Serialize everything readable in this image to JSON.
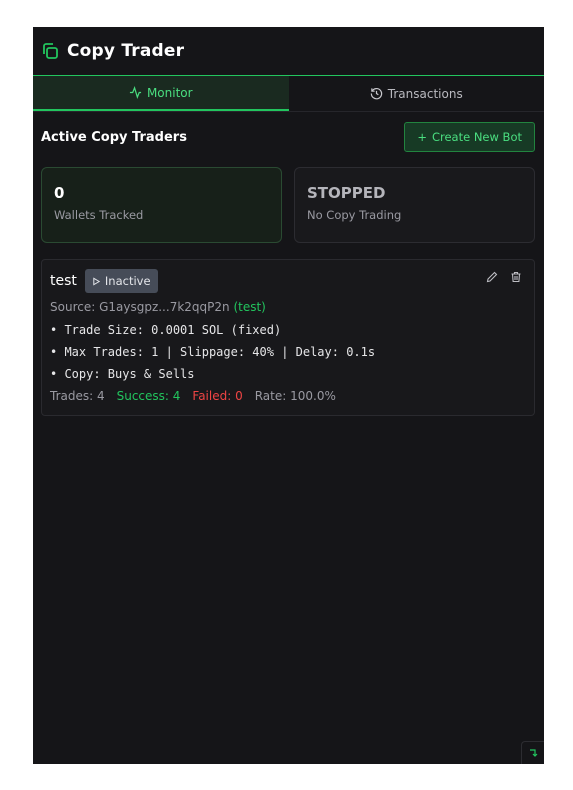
{
  "app": {
    "title": "Copy Trader"
  },
  "tabs": [
    {
      "label": "Monitor",
      "icon": "activity-icon",
      "active": true
    },
    {
      "label": "Transactions",
      "icon": "history-icon",
      "active": false
    }
  ],
  "section": {
    "title": "Active Copy Traders",
    "create_label": "Create New Bot",
    "create_prefix": "+"
  },
  "stats": [
    {
      "value": "0",
      "label": "Wallets Tracked"
    },
    {
      "value": "STOPPED",
      "label": "No Copy Trading"
    }
  ],
  "bot": {
    "name": "test",
    "status": "Inactive",
    "source_label": "Source: G1aysgpz...7k2qqP2n",
    "source_tag": "(test)",
    "details": [
      "• Trade Size: 0.0001 SOL (fixed)",
      "• Max Trades: 1 | Slippage: 40% | Delay: 0.1s",
      "• Copy: Buys & Sells"
    ],
    "trades": "Trades: 4",
    "success": "Success: 4",
    "failed": "Failed: 0",
    "rate": "Rate: 100.0%"
  },
  "colors": {
    "accent": "#22c55e",
    "background": "#151518",
    "danger": "#ef4444"
  }
}
